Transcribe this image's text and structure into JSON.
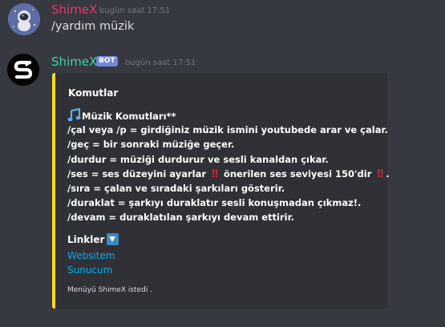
{
  "messages": [
    {
      "author": "ShimeX",
      "timestamp": "bugün saat 17:51",
      "text": "/yardım müzik",
      "avatar_icon": "astronaut-avatar-icon"
    },
    {
      "author": "ShimeX",
      "bot_tag": "BOT",
      "timestamp": "bugün saat 17:51",
      "avatar_icon": "shimex-logo-avatar-icon",
      "embed": {
        "accent_color": "#f7dc1b",
        "title": "Komutlar",
        "section_title": "Müzik Komutları**",
        "commands": [
          "/çal veya /p = girdiğiniz müzik ismini youtubede arar ve çalar.",
          "/geç = bir sonraki müziğe geçer.",
          "/durdur = müziği durdurur ve sesli kanaldan çıkar."
        ],
        "ses_line": {
          "prefix": "/ses = ses düzeyini ayarlar",
          "middle": "önerilen ses seviyesi 150'dir",
          "suffix": ".",
          "emphasis_glyph": "!!"
        },
        "commands_after": [
          "/sıra = çalan ve sıradaki şarkıları gösterir.",
          "/duraklat = şarkıyı duraklatır sesli konuşmadan çıkmaz!.",
          "/devam = duraklatılan şarkıyı devam ettirir."
        ],
        "links_title": "Linkler",
        "links": [
          "Websitem",
          "Sunucum"
        ],
        "footer": "Menüyü ShimeX istedi ."
      }
    }
  ],
  "colors": {
    "background": "#36393f",
    "embed_background": "#2f3136",
    "user_name": "#e3386f",
    "bot_name": "#3fd1a7",
    "bot_tag": "#7289da",
    "link": "#00b0f4"
  }
}
